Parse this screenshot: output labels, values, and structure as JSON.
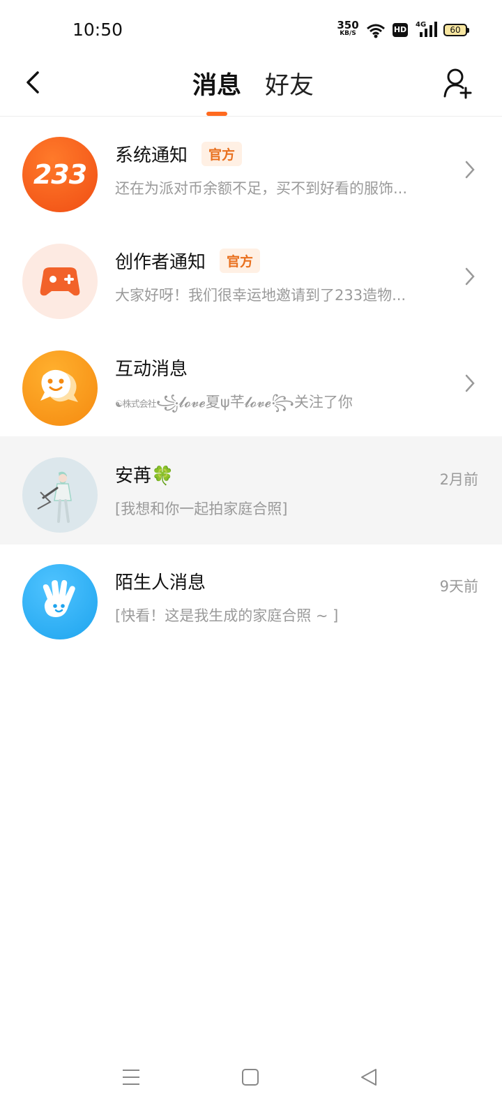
{
  "status_bar": {
    "time": "10:50",
    "net_speed_top": "350",
    "net_speed_bottom": "KB/S",
    "hd": "HD",
    "signal_label": "4G",
    "battery": "60"
  },
  "header": {
    "tab_messages": "消息",
    "tab_friends": "好友",
    "accent": "#FF6A1F"
  },
  "messages": [
    {
      "title": "系统通知",
      "badge": "官方",
      "preview": "还在为派对币余额不足，买不到好看的服饰...",
      "avatar_text": "233",
      "right": "chevron"
    },
    {
      "title": "创作者通知",
      "badge": "官方",
      "preview": "大家好呀！我们很幸运地邀请到了233造物...",
      "right": "chevron"
    },
    {
      "title": "互动消息",
      "preview_prefix": "☯株式会社",
      "preview_name": "꧁𝓵𝓸𝓿𝓮夏ψ芊𝓵𝓸𝓿𝓮꧂",
      "preview_suffix": "关注了你",
      "right": "chevron"
    },
    {
      "title": "安苒🍀",
      "preview": "[我想和你一起拍家庭合照]",
      "time": "2月前"
    },
    {
      "title": "陌生人消息",
      "preview": "[快看！这是我生成的家庭合照 ~ ]",
      "time": "9天前"
    }
  ]
}
